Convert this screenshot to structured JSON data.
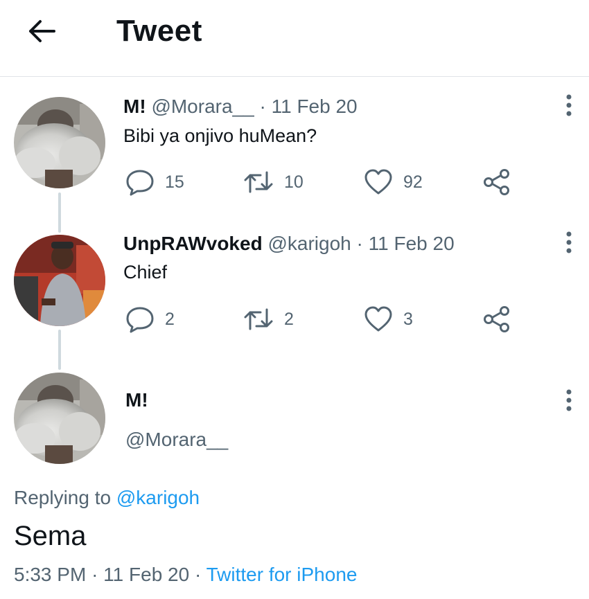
{
  "header": {
    "title": "Tweet"
  },
  "thread": [
    {
      "name": "M!",
      "handle": "@Morara__",
      "date": "11 Feb 20",
      "text": "Bibi ya onjivo huMean?",
      "replies": "15",
      "retweets": "10",
      "likes": "92"
    },
    {
      "name": "UnpRAWvoked",
      "handle": "@karigoh",
      "date": "11 Feb 20",
      "text": "Chief",
      "replies": "2",
      "retweets": "2",
      "likes": "3"
    }
  ],
  "main_tweet": {
    "name": "M!",
    "handle": "@Morara__",
    "replying_prefix": "Replying to",
    "replying_to": "@karigoh",
    "text": "Sema",
    "time": "5:33 PM",
    "date": "11 Feb 20",
    "source": "Twitter for iPhone"
  },
  "separator": "·",
  "icons": [
    "back-arrow-icon",
    "reply-icon",
    "retweet-icon",
    "like-icon",
    "share-icon",
    "more-icon"
  ],
  "colors": {
    "link": "#1d9bf0",
    "secondary": "#536471",
    "text": "#0f1419",
    "thread_line": "#cfd9de"
  }
}
